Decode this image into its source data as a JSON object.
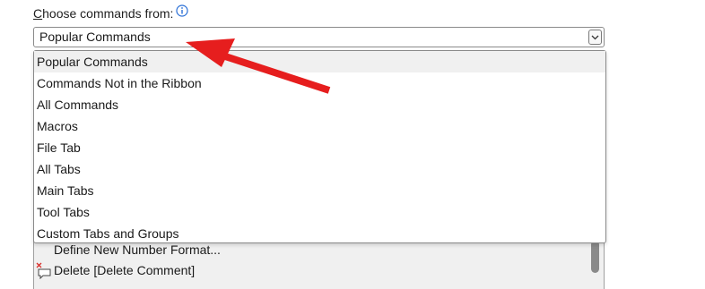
{
  "label": {
    "prefix": "C",
    "rest": "hoose commands from:"
  },
  "icons": {
    "info": "info-icon",
    "dropdown": "chevron-down-icon",
    "delete_comment": "delete-comment-icon",
    "annotation": "red-arrow"
  },
  "combo": {
    "value": "Popular Commands"
  },
  "dropdown": {
    "options": [
      "Popular Commands",
      "Commands Not in the Ribbon",
      "All Commands",
      "Macros",
      "File Tab",
      "All Tabs",
      "Main Tabs",
      "Tool Tabs",
      "Custom Tabs and Groups"
    ],
    "selected_index": 0
  },
  "list_behind": {
    "items": [
      {
        "label": "Define New Number Format..."
      },
      {
        "label": "Delete [Delete Comment]"
      }
    ]
  },
  "colors": {
    "accent": "#2a6fd6",
    "arrow": "#e61e1e",
    "selected_bg": "#f0f0f0"
  }
}
